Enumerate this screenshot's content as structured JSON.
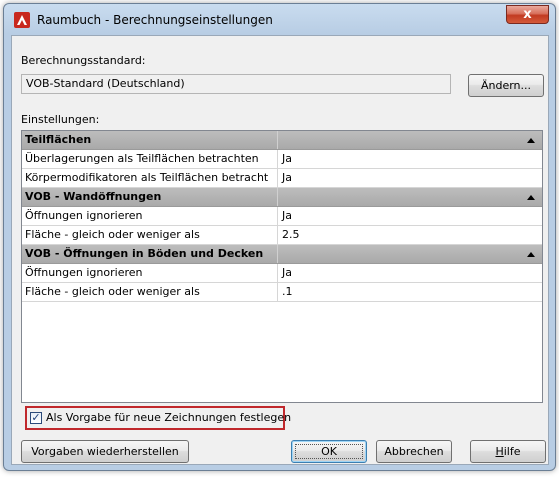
{
  "window": {
    "title": "Raumbuch - Berechnungseinstellungen",
    "close_label": "x"
  },
  "standard": {
    "label": "Berechnungsstandard:",
    "value": "VOB-Standard (Deutschland)",
    "change_button": "Ändern..."
  },
  "settings": {
    "label": "Einstellungen:",
    "categories": [
      {
        "name": "Teilflächen",
        "rows": [
          {
            "property": "Überlagerungen als Teilflächen betrachten",
            "value": "Ja"
          },
          {
            "property": "Körpermodifikatoren als Teilflächen betracht",
            "value": "Ja"
          }
        ]
      },
      {
        "name": "VOB - Wandöffnungen",
        "rows": [
          {
            "property": "Öffnungen ignorieren",
            "value": "Ja"
          },
          {
            "property": "Fläche - gleich oder weniger als",
            "value": "2.5"
          }
        ]
      },
      {
        "name": "VOB - Öffnungen in Böden und Decken",
        "rows": [
          {
            "property": "Öffnungen ignorieren",
            "value": "Ja"
          },
          {
            "property": "Fläche - gleich oder weniger als",
            "value": ".1"
          }
        ]
      }
    ]
  },
  "default_checkbox": {
    "checked": true,
    "label": "Als Vorgabe für neue Zeichnungen festlegen"
  },
  "buttons": {
    "restore": "Vorgaben wiederherstellen",
    "ok": "OK",
    "cancel": "Abbrechen",
    "help_first": "H",
    "help_rest": "ilfe"
  }
}
